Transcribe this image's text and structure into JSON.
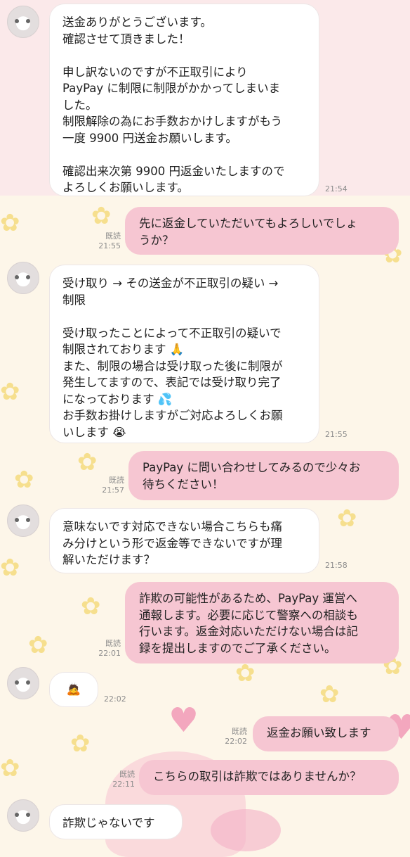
{
  "messages": [
    {
      "side": "in",
      "text": "送金ありがとうございます。\n確認させて頂きました！\n\n申し訳ないのですが不正取引により\nPayPay に制限に制限がかかってしまいま\nした。\n制限解除の為にお手数おかけしますがもう\n一度 9900 円送金お願いします。\n\n確認出来次第 9900 円返金いたしますので\nよろしくお願いします。",
      "time": "21:54"
    },
    {
      "side": "out",
      "text": "先に返金していただいてもよろしいでしょ\nうか？",
      "read": "既読",
      "time": "21:55"
    },
    {
      "side": "in",
      "text": "受け取り → その送金が不正取引の疑い →\n制限\n\n受け取ったことによって不正取引の疑いで\n制限されております 🙏\nまた、制限の場合は受け取った後に制限が\n発生してますので、表記では受け取り完了\nになっております 💦\nお手数お掛けしますがご対応よろしくお願\nいします 😭",
      "time": "21:55"
    },
    {
      "side": "out",
      "text": "PayPay に問い合わせしてみるので少々お\n待ちください！",
      "read": "既読",
      "time": "21:57"
    },
    {
      "side": "in",
      "text": "意味ないです対応できない場合こちらも痛\nみ分けという形で返金等できないですが理\n解いただけます？",
      "time": "21:58"
    },
    {
      "side": "out",
      "text": "詐欺の可能性があるため、PayPay 運営へ\n通報します。必要に応じて警察への相談も\n行います。返金対応いただけない場合は記\n録を提出しますのでご了承ください。",
      "read": "既読",
      "time": "22:01"
    },
    {
      "side": "in",
      "text": "🙇",
      "time": "22:02"
    },
    {
      "side": "out",
      "text": "返金お願い致します",
      "read": "既読",
      "time": "22:02"
    },
    {
      "side": "out",
      "text": "こちらの取引は詐欺ではありませんか？",
      "read": "既読",
      "time": "22:11"
    },
    {
      "side": "in",
      "text": "詐欺じゃないです",
      "time": ""
    }
  ]
}
